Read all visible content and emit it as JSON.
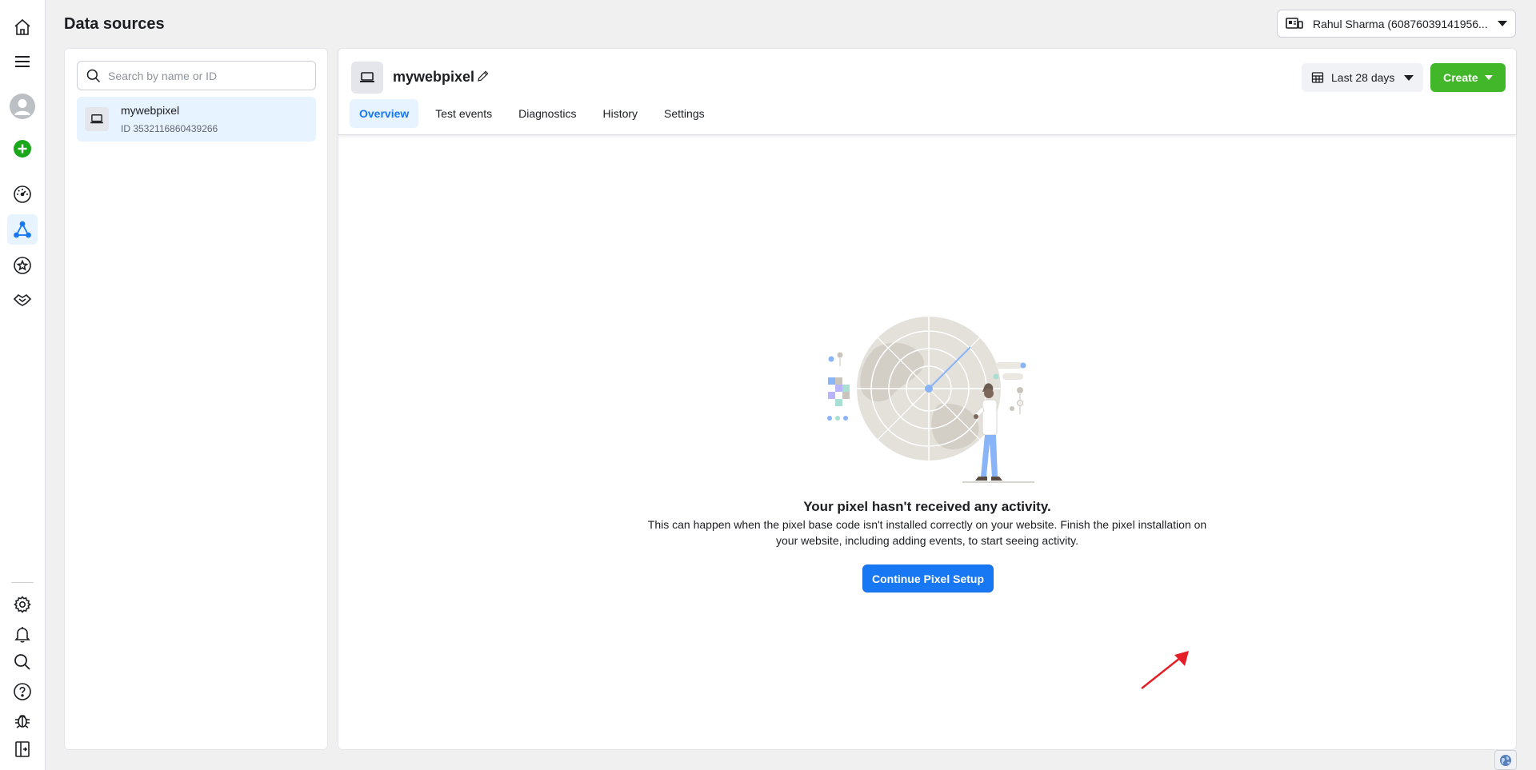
{
  "header": {
    "page_title": "Data sources",
    "account_label": "Rahul Sharma (60876039141956..."
  },
  "sidebar": {
    "search_placeholder": "Search by name or ID",
    "items": [
      {
        "name": "mywebpixel",
        "id_text": "ID 3532116860439266",
        "selected": true
      }
    ]
  },
  "main": {
    "pixel_name": "mywebpixel",
    "tabs": [
      {
        "label": "Overview",
        "active": true
      },
      {
        "label": "Test events",
        "active": false
      },
      {
        "label": "Diagnostics",
        "active": false
      },
      {
        "label": "History",
        "active": false
      },
      {
        "label": "Settings",
        "active": false
      }
    ],
    "date_range_label": "Last 28 days",
    "create_label": "Create",
    "empty_state": {
      "title": "Your pixel hasn't received any activity.",
      "description": "This can happen when the pixel base code isn't installed correctly on your website. Finish the pixel installation on your website, including adding events, to start seeing activity.",
      "cta_label": "Continue Pixel Setup"
    }
  },
  "nav_rail": {
    "icons": [
      "home-icon",
      "menu-icon",
      "avatar",
      "add-icon",
      "dashboard-icon",
      "events-manager-icon",
      "star-icon",
      "partners-icon",
      "settings-icon",
      "bell-icon",
      "search-icon",
      "help-icon",
      "bug-icon",
      "panel-toggle-icon"
    ],
    "active_item": "events-manager-icon"
  },
  "colors": {
    "primary": "#1877f2",
    "create_green": "#42b72a",
    "selected_bg": "#e7f3ff",
    "page_bg": "#f0f0f0",
    "annotation_arrow": "#e41e26"
  }
}
